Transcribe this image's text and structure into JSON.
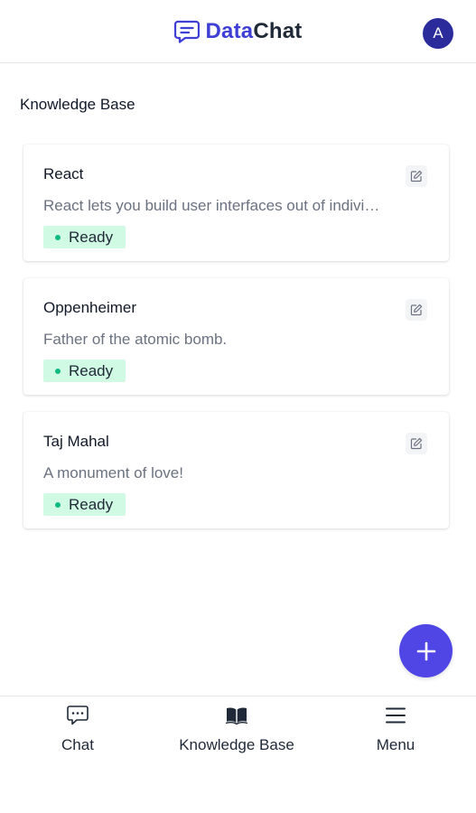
{
  "header": {
    "brand_part1": "Data",
    "brand_part2": "Chat",
    "brand_icon": "chat-bubble-icon",
    "avatar_initial": "A"
  },
  "page": {
    "title": "Knowledge Base"
  },
  "cards": [
    {
      "title": "React",
      "description": "React lets you build user interfaces out of individual pieces called components",
      "status": "Ready"
    },
    {
      "title": "Oppenheimer",
      "description": "Father of the atomic bomb.",
      "status": "Ready"
    },
    {
      "title": "Taj Mahal",
      "description": "A monument of love!",
      "status": "Ready"
    }
  ],
  "fab": {
    "icon": "plus-icon"
  },
  "bottom_nav": [
    {
      "label": "Chat",
      "icon": "chat-icon"
    },
    {
      "label": "Knowledge Base",
      "icon": "book-icon"
    },
    {
      "label": "Menu",
      "icon": "hamburger-icon"
    }
  ],
  "colors": {
    "brand": "#3f3fd6",
    "avatar": "#2b2b9c",
    "fab": "#4f46e5",
    "status_bg": "#d1fae5",
    "status_dot": "#10b981"
  }
}
